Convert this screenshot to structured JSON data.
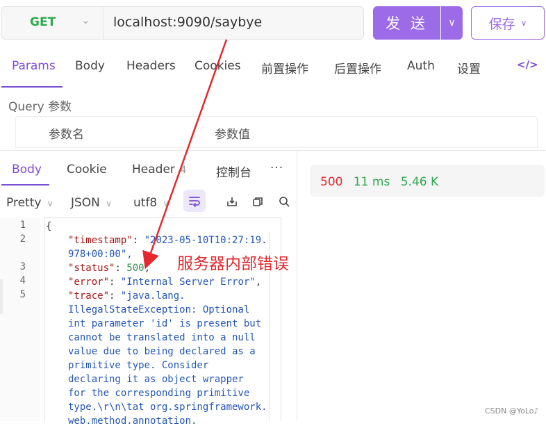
{
  "request": {
    "method": "GET",
    "url": "localhost:9090/saybye",
    "send_label": "发 送",
    "save_label": "保存"
  },
  "request_tabs": [
    {
      "label": "Params",
      "active": true
    },
    {
      "label": "Body"
    },
    {
      "label": "Headers"
    },
    {
      "label": "Cookies"
    },
    {
      "label": "前置操作"
    },
    {
      "label": "后置操作"
    },
    {
      "label": "Auth"
    },
    {
      "label": "设置"
    }
  ],
  "query": {
    "label": "Query 参数",
    "columns": [
      "参数名",
      "参数值"
    ]
  },
  "response_tabs": [
    {
      "label": "Body",
      "active": true
    },
    {
      "label": "Cookie"
    },
    {
      "label": "Header",
      "count": "4"
    },
    {
      "label": "控制台"
    }
  ],
  "format": {
    "mode": "Pretty",
    "type": "JSON",
    "encoding": "utf8"
  },
  "status": {
    "code": "500",
    "time": "11 ms",
    "size": "5.46 K"
  },
  "code_lines": [
    {
      "num": "1",
      "text": "{"
    },
    {
      "num": "2",
      "key": "\"timestamp\"",
      "value": "\"2023-05-10T10:27:19.",
      "cont": [
        "978+00:00\","
      ]
    },
    {
      "num": "3",
      "key": "\"status\"",
      "value": "500"
    },
    {
      "num": "4",
      "key": "\"error\"",
      "value": "\"Internal Server Error\""
    },
    {
      "num": "5",
      "key": "\"trace\"",
      "value": "\"java.lang.",
      "cont": [
        "IllegalStateException: Optional",
        "int parameter 'id' is present but",
        "cannot be translated into a null",
        "value due to being declared as a",
        "primitive type. Consider",
        "declaring it as object wrapper",
        "for the corresponding primitive",
        "type.\\r\\n\\tat org.springframework.",
        "web.method.annotation."
      ]
    }
  ],
  "annotation": "服务器内部错误",
  "watermark": "CSDN @YoLo♪",
  "colors": {
    "accent": "#9b6be8",
    "method_get": "#2fa84f",
    "status_error": "#e4282e",
    "status_ok": "#2fa84f",
    "annotation": "#e4282e"
  }
}
